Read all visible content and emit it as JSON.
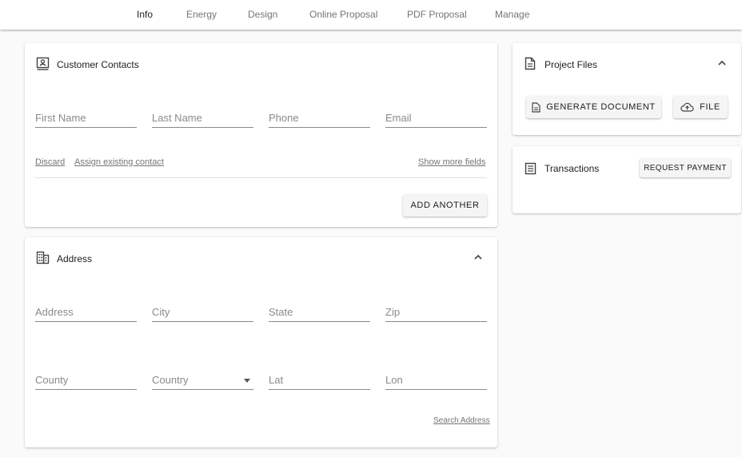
{
  "tabs": [
    {
      "label": "Info",
      "active": true
    },
    {
      "label": "Energy"
    },
    {
      "label": "Design"
    },
    {
      "label": "Online Proposal"
    },
    {
      "label": "PDF Proposal"
    },
    {
      "label": "Manage"
    }
  ],
  "contacts": {
    "title": "Customer Contacts",
    "fields": {
      "first_name": {
        "placeholder": "First Name",
        "value": ""
      },
      "last_name": {
        "placeholder": "Last Name",
        "value": ""
      },
      "phone": {
        "placeholder": "Phone",
        "value": ""
      },
      "email": {
        "placeholder": "Email",
        "value": ""
      }
    },
    "discard": "Discard",
    "assign_existing": "Assign existing contact",
    "show_more": "Show more fields",
    "add_another": "ADD ANOTHER"
  },
  "address": {
    "title": "Address",
    "fields": {
      "address": {
        "placeholder": "Address",
        "value": ""
      },
      "city": {
        "placeholder": "City",
        "value": ""
      },
      "state": {
        "placeholder": "State",
        "value": ""
      },
      "zip": {
        "placeholder": "Zip",
        "value": ""
      },
      "county": {
        "placeholder": "County",
        "value": ""
      },
      "country": {
        "placeholder": "Country",
        "value": ""
      },
      "lat": {
        "placeholder": "Lat",
        "value": ""
      },
      "lon": {
        "placeholder": "Lon",
        "value": ""
      }
    },
    "search_address": "Search Address"
  },
  "project_files": {
    "title": "Project Files",
    "generate_document": "GENERATE DOCUMENT",
    "file": "FILE"
  },
  "transactions": {
    "title": "Transactions",
    "request_payment": "REQUEST PAYMENT"
  },
  "icons": {
    "contacts": "contact-card-icon",
    "address": "building-icon",
    "project_files": "document-icon",
    "transactions": "receipt-icon",
    "upload": "cloud-upload-icon",
    "collapse": "chevron-up-icon"
  }
}
